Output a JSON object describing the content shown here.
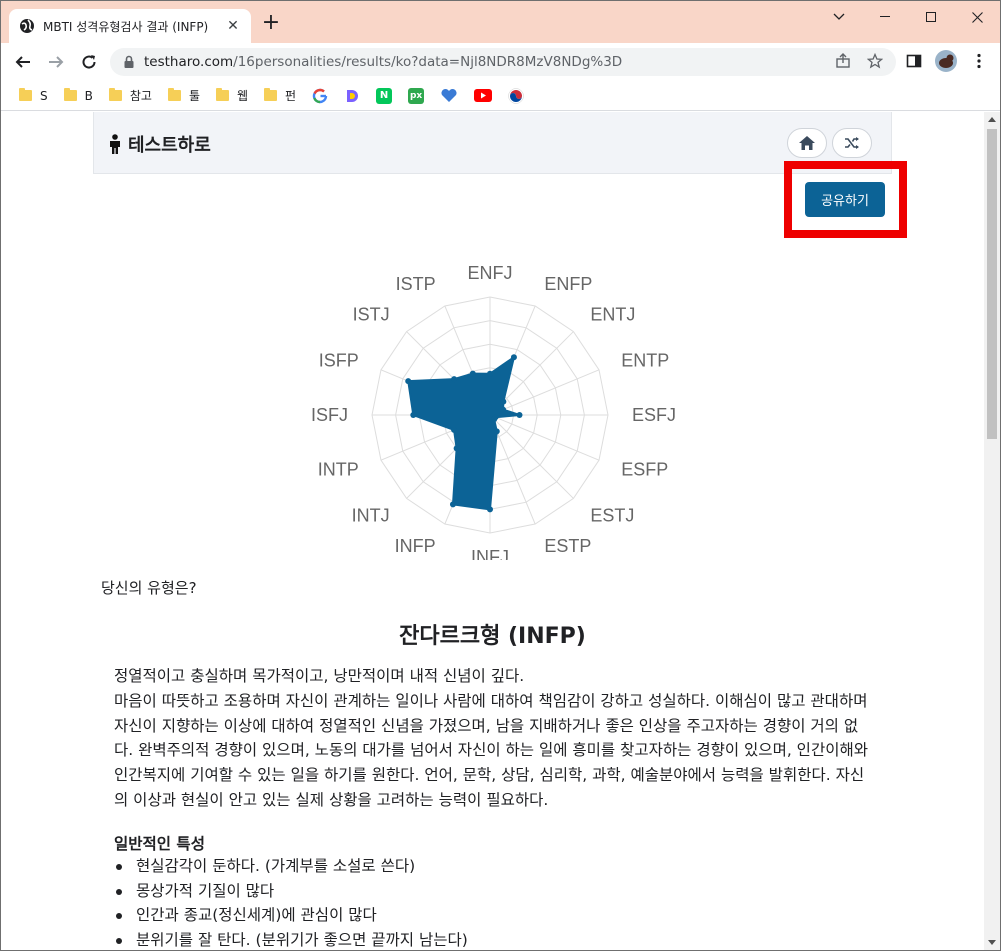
{
  "browser": {
    "tab_title": "MBTI 성격유형검사 결과 (INFP)",
    "url_host": "testharo.com",
    "url_path": "/16personalities/results/ko?data=Njl8NDR8MzV8NDg%3D",
    "bookmarks": [
      "S",
      "B",
      "참고",
      "툴",
      "웹",
      "펀"
    ],
    "tab_color": "#f9d6c8"
  },
  "site": {
    "brand": "테스트하로",
    "share_label": "공유하기",
    "accent_color": "#0c6396"
  },
  "chart_data": {
    "type": "radar",
    "categories": [
      "ENFJ",
      "ENFP",
      "ENTJ",
      "ENTP",
      "ESFJ",
      "ESFP",
      "ESTJ",
      "ESTP",
      "INFJ",
      "INFP",
      "INTJ",
      "INTP",
      "ISFJ",
      "ISFP",
      "ISTJ",
      "ISTP"
    ],
    "values": [
      35,
      53,
      16,
      12,
      25,
      5,
      5,
      15,
      80,
      82,
      40,
      33,
      65,
      75,
      43,
      38
    ],
    "rmax": 100,
    "fill_color": "#0c6396",
    "grid": true
  },
  "result": {
    "question": "당신의 유형은?",
    "type_name": "잔다르크형 (INFP)",
    "description": [
      "정열적이고 충실하며 목가적이고, 낭만적이며 내적 신념이 깊다.",
      "마음이 따뜻하고 조용하며 자신이 관계하는 일이나 사람에 대하여 책임감이 강하고 성실하다. 이해심이 많고 관대하며 자신이 지향하는 이상에 대하여 정열적인 신념을 가졌으며, 남을 지배하거나 좋은 인상을 주고자하는 경향이 거의 없다. 완벽주의적 경향이 있으며, 노동의 대가를 넘어서 자신이 하는 일에 흥미를 찾고자하는 경향이 있으며, 인간이해와 인간복지에 기여할 수 있는 일을 하기를 원한다. 언어, 문학, 상담, 심리학, 과학, 예술분야에서 능력을 발휘한다. 자신의 이상과 현실이 안고 있는 실제 상황을 고려하는 능력이 필요하다."
    ],
    "traits_title": "일반적인 특성",
    "traits": [
      "현실감각이 둔하다. (가계부를 소설로 쓴다)",
      "몽상가적 기질이 많다",
      "인간과 종교(정신세계)에 관심이 많다",
      "분위기를 잘 탄다. (분위기가 좋으면 끝까지 남는다)"
    ]
  }
}
